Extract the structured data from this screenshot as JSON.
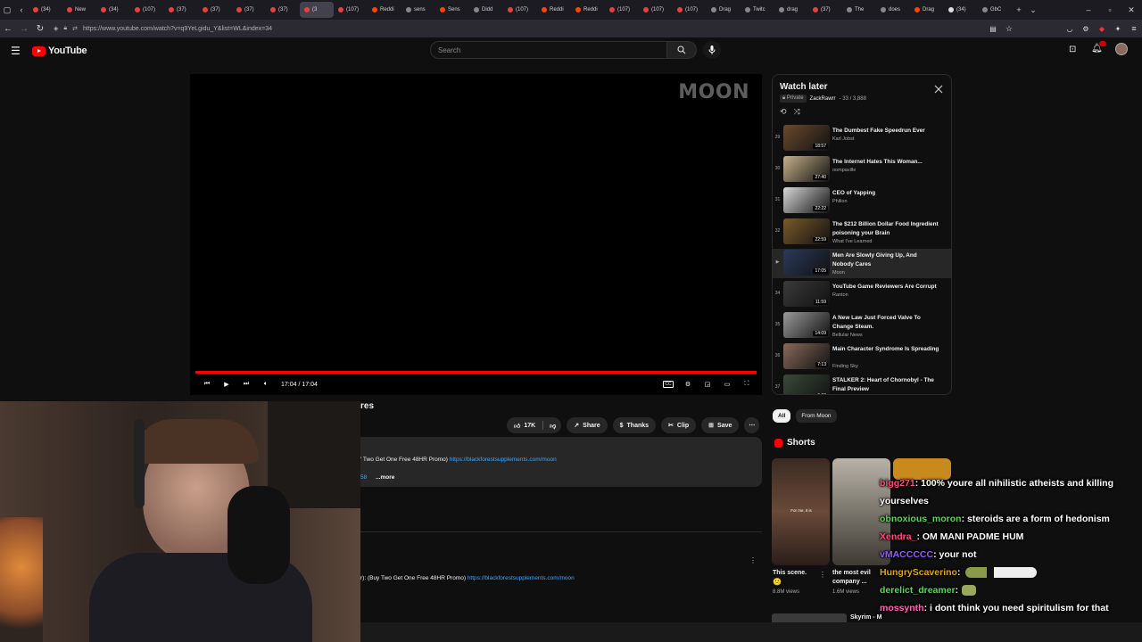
{
  "browser": {
    "tabs": [
      {
        "label": "(34)",
        "icon": "youtube-favicon",
        "color": "#e0443d"
      },
      {
        "label": "New",
        "icon": "youtube-favicon",
        "color": "#e0443d"
      },
      {
        "label": "(34)",
        "icon": "youtube-favicon",
        "color": "#e0443d"
      },
      {
        "label": "(107)",
        "icon": "youtube-favicon",
        "color": "#e0443d"
      },
      {
        "label": "(37)",
        "icon": "youtube-favicon",
        "color": "#e0443d"
      },
      {
        "label": "(37)",
        "icon": "youtube-favicon",
        "color": "#e0443d"
      },
      {
        "label": "(37)",
        "icon": "youtube-favicon",
        "color": "#e0443d"
      },
      {
        "label": "(37)",
        "icon": "youtube-favicon",
        "color": "#e0443d"
      },
      {
        "label": "(3",
        "icon": "youtube-favicon",
        "color": "#e0443d",
        "active": true
      },
      {
        "label": "(107)",
        "icon": "youtube-favicon",
        "color": "#e0443d"
      },
      {
        "label": "Reddi",
        "icon": "reddit-favicon",
        "color": "#ff4500"
      },
      {
        "label": "sens",
        "icon": "generic-favicon",
        "color": "#888888"
      },
      {
        "label": "Sens",
        "icon": "reddit-favicon",
        "color": "#ff4500"
      },
      {
        "label": "Didd",
        "icon": "generic-favicon",
        "color": "#888888"
      },
      {
        "label": "(107)",
        "icon": "youtube-favicon",
        "color": "#e0443d"
      },
      {
        "label": "Reddi",
        "icon": "reddit-favicon",
        "color": "#ff4500"
      },
      {
        "label": "Reddi",
        "icon": "reddit-favicon",
        "color": "#ff4500"
      },
      {
        "label": "(107)",
        "icon": "youtube-favicon",
        "color": "#e0443d"
      },
      {
        "label": "(107)",
        "icon": "youtube-favicon",
        "color": "#e0443d"
      },
      {
        "label": "(107)",
        "icon": "youtube-favicon",
        "color": "#e0443d"
      },
      {
        "label": "Drag",
        "icon": "generic-favicon",
        "color": "#888888"
      },
      {
        "label": "Twitc",
        "icon": "generic-favicon",
        "color": "#888888"
      },
      {
        "label": "drag",
        "icon": "generic-favicon",
        "color": "#888888"
      },
      {
        "label": "(37)",
        "icon": "youtube-favicon",
        "color": "#e0443d"
      },
      {
        "label": "The",
        "icon": "generic-favicon",
        "color": "#888888"
      },
      {
        "label": "does",
        "icon": "generic-favicon",
        "color": "#888888"
      },
      {
        "label": "Drag",
        "icon": "reddit-favicon",
        "color": "#ff4500"
      },
      {
        "label": "(34)",
        "icon": "x-favicon",
        "color": "#dddddd"
      },
      {
        "label": "GbC",
        "icon": "generic-favicon",
        "color": "#888888"
      }
    ],
    "url": "https://www.youtube.com/watch?v=q9YeLgidu_Y&list=WL&index=34"
  },
  "youtube": {
    "logo_text": "YouTube",
    "search_placeholder": "Search"
  },
  "player": {
    "watermark": "MOON",
    "time": "17:04 / 17:04",
    "progress_fraction": 1.0,
    "progress_color": "#ff0000"
  },
  "playlist": {
    "title": "Watch later",
    "privacy": "Private",
    "owner": "ZackRawrr",
    "position": "- 33 / 3,888",
    "items": [
      {
        "num": "29",
        "title": "The Dumbest Fake Speedrun Ever",
        "channel": "Karl Jobst",
        "duration": "18:57",
        "color": "#6b4a2e"
      },
      {
        "num": "30",
        "title": "The Internet Hates This Woman...",
        "channel": "oompaville",
        "duration": "27:40",
        "color": "#c7b089"
      },
      {
        "num": "31",
        "title": "CEO of Yapping",
        "channel": "Philion",
        "duration": "22:22",
        "color": "#d8d8d8"
      },
      {
        "num": "32",
        "title": "The $212 Billion Dollar Food Ingredient poisoning your Brain",
        "channel": "What I've Learned",
        "duration": "22:59",
        "color": "#7a5a2a"
      },
      {
        "num": "",
        "title": "Men Are Slowly Giving Up, And Nobody Cares",
        "channel": "Moon",
        "duration": "17:05",
        "color": "#2a3a5a",
        "active": true
      },
      {
        "num": "34",
        "title": "YouTube Game Reviewers Are Corrupt",
        "channel": "Ranton",
        "duration": "11:59",
        "color": "#3a3a3a"
      },
      {
        "num": "35",
        "title": "A New Law Just Forced Valve To Change Steam.",
        "channel": "Bellular News",
        "duration": "14:09",
        "color": "#9a9a9a"
      },
      {
        "num": "36",
        "title": "Main Character Syndrome Is Spreading",
        "channel": "Finding Sky",
        "duration": "7:13",
        "color": "#8a6a5a"
      },
      {
        "num": "37",
        "title": "STALKER 2: Heart of Chornobyl - The Final Preview",
        "channel": "IGN",
        "duration": "8:30",
        "color": "#3a4a3a"
      }
    ]
  },
  "video": {
    "title_fragment": "res",
    "likes": "17K",
    "share": "Share",
    "thanks": "Thanks",
    "clip": "Clip",
    "save": "Save",
    "desc_text": "' Two Get One Free 48HR Promo)",
    "desc_link": "https://blackforestsupplements.com/moon",
    "desc_frag2": "58",
    "desc_more": "...more",
    "comment_text": "r): (Buy Two Get One Free 48HR Promo)",
    "comment_link": "https://blackforestsupplements.com/moon"
  },
  "sidebar": {
    "chips": [
      "All",
      "From Moon"
    ],
    "shorts_label": "Shorts",
    "shorts": [
      {
        "title": "This scene.",
        "views": "8.8M views",
        "overlay": "For me, it is",
        "color": "#5a4032"
      },
      {
        "title": "the most evil company ...",
        "views": "1.6M views",
        "color": "#8a8478"
      },
      {
        "title": "",
        "views": "",
        "color": "#c8891e"
      }
    ],
    "next_title": "Skyrim - M"
  },
  "chat": [
    {
      "user": "bigg271",
      "color": "#ff4d7d",
      "text": ": 100% youre all nihilistic atheists and killing yourselves"
    },
    {
      "user": "obnoxious_moron",
      "color": "#5cd65c",
      "text": ": steroids are a form of hedonism"
    },
    {
      "user": "Xendra_",
      "color": "#ff4d7d",
      "text": ": OM MANI PADME HUM"
    },
    {
      "user": "vMACCCCC",
      "color": "#8f5cff",
      "text": ": your not"
    },
    {
      "user": "HungryScaverino",
      "color": "#daa520",
      "text": ":"
    },
    {
      "user": "derelict_dreamer",
      "color": "#5cd65c",
      "text": ":"
    },
    {
      "user": "mossynth",
      "color": "#ff69b4",
      "text": ": i dont think you need spiritulism for that"
    }
  ]
}
